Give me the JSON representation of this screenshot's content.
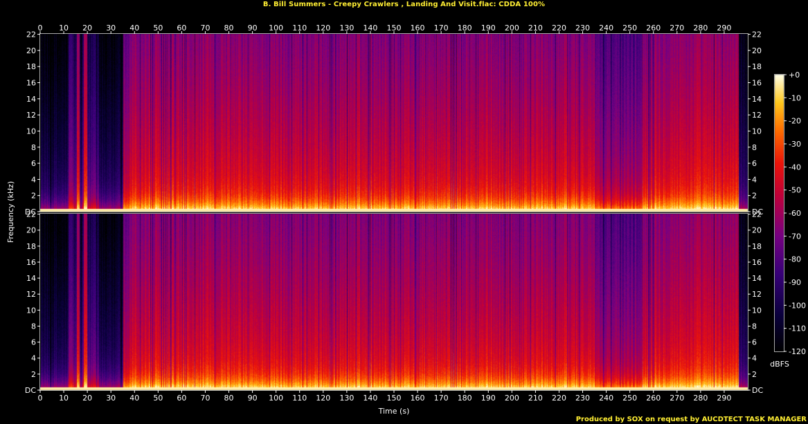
{
  "title": "B. Bill Summers - Creepy Crawlers , Landing And Visit.flac: CDDA 100%",
  "credit": "Produced by SOX on request by AUCDTECT TASK MANAGER",
  "chart_data": {
    "type": "heatmap",
    "title": "B. Bill Summers - Creepy Crawlers , Landing And Visit.flac: CDDA 100%",
    "xlabel": "Time (s)",
    "ylabel": "Frequency (kHz)",
    "colorbar_label": "dBFS",
    "xlim": [
      0,
      300
    ],
    "ylim": [
      0,
      22.05
    ],
    "x_ticks": [
      0,
      10,
      20,
      30,
      40,
      50,
      60,
      70,
      80,
      90,
      100,
      110,
      120,
      130,
      140,
      150,
      160,
      170,
      180,
      190,
      200,
      210,
      220,
      230,
      240,
      250,
      260,
      270,
      280,
      290
    ],
    "y_ticks": [
      "DC",
      "2",
      "4",
      "6",
      "8",
      "10",
      "12",
      "14",
      "16",
      "18",
      "20",
      "22"
    ],
    "y_tick_values": [
      0,
      2,
      4,
      6,
      8,
      10,
      12,
      14,
      16,
      18,
      20,
      22
    ],
    "colorbar_ticks": [
      "+0",
      "-10",
      "-20",
      "-30",
      "-40",
      "-50",
      "-60",
      "-70",
      "-80",
      "-90",
      "-100",
      "-110",
      "-120"
    ],
    "colorbar_values": [
      0,
      -10,
      -20,
      -30,
      -40,
      -50,
      -60,
      -70,
      -80,
      -90,
      -100,
      -110,
      -120
    ],
    "channels": [
      "upper",
      "lower"
    ],
    "colors": {
      "title": "#ffee33",
      "axis": "#ffffff",
      "frame": "#aaaaaa",
      "background": "#000000"
    }
  }
}
